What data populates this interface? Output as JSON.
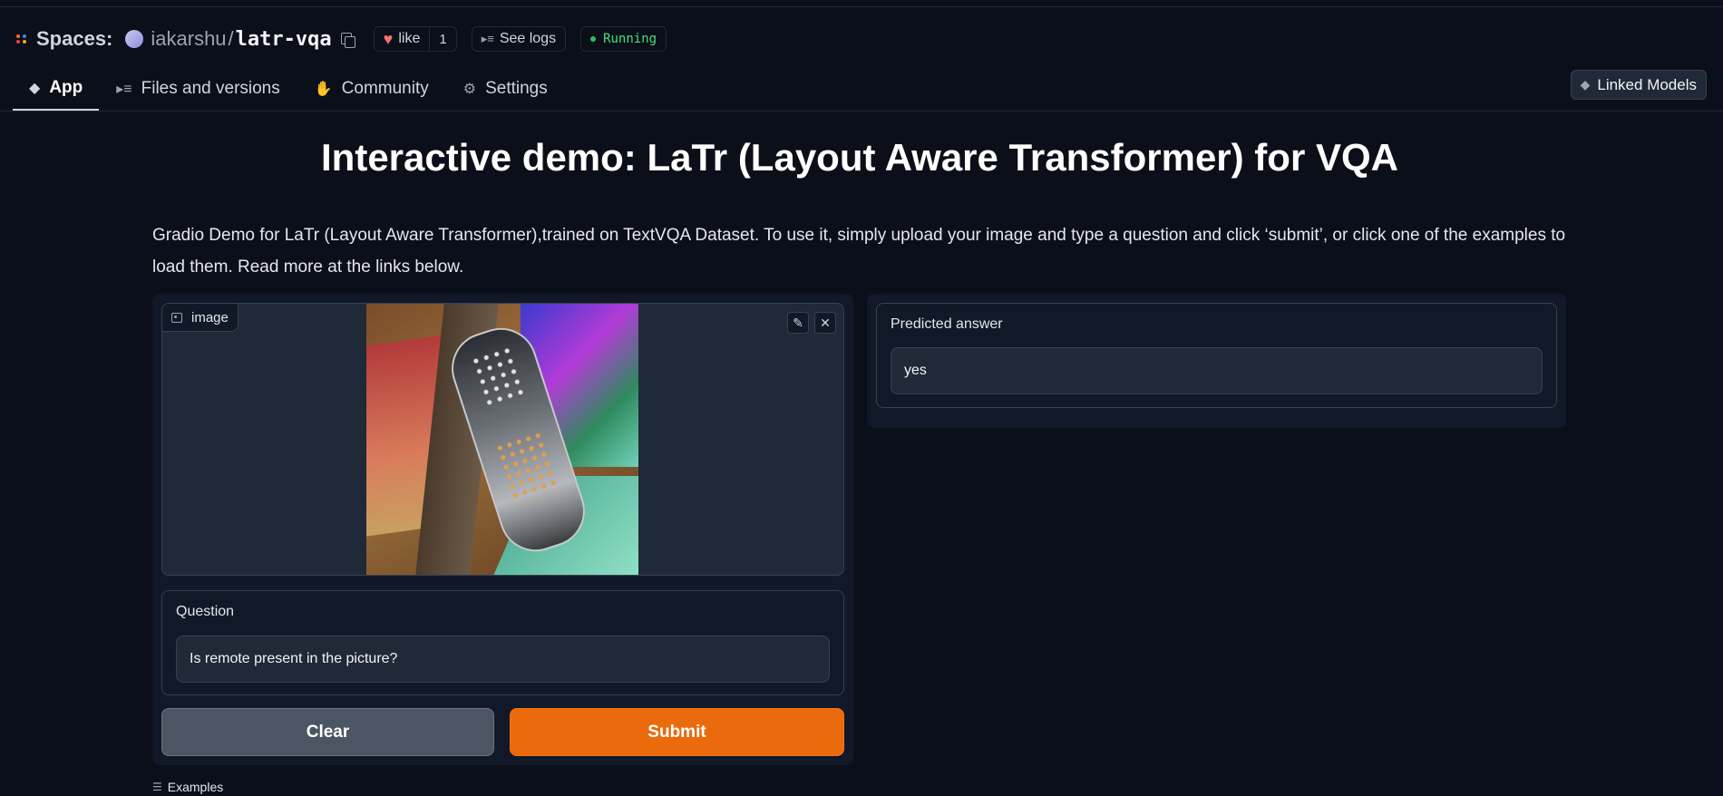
{
  "header": {
    "spaces_label": "Spaces:",
    "owner": "iakarshu",
    "slash": "/",
    "repo": "latr-vqa",
    "like_label": "like",
    "like_count": "1",
    "logs_label": "See logs",
    "status": "Running",
    "logo_colors": [
      "#f97316",
      "#3b82f6",
      "#ef4444",
      "#eab308"
    ]
  },
  "tabs": [
    {
      "label": "App",
      "icon": "cube-icon"
    },
    {
      "label": "Files and versions",
      "icon": "files-icon"
    },
    {
      "label": "Community",
      "icon": "hand-icon"
    },
    {
      "label": "Settings",
      "icon": "gear-icon"
    }
  ],
  "linked_models_label": "Linked Models",
  "page": {
    "title": "Interactive demo: LaTr (Layout Aware Transformer) for VQA",
    "description": "Gradio Demo for LaTr (Layout Aware Transformer),trained on TextVQA Dataset. To use it, simply upload your image and type a question and click ‘submit’, or click one of the examples to load them. Read more at the links below."
  },
  "inputs": {
    "image_label": "image",
    "question_label": "Question",
    "question_value": "Is remote present in the picture?"
  },
  "buttons": {
    "clear": "Clear",
    "submit": "Submit"
  },
  "output": {
    "label": "Predicted answer",
    "value": "yes"
  },
  "examples_label": "Examples",
  "colors": {
    "background": "#0b0f19",
    "panel": "#111827",
    "submit": "#ea6a0c",
    "status": "#4ade80"
  }
}
